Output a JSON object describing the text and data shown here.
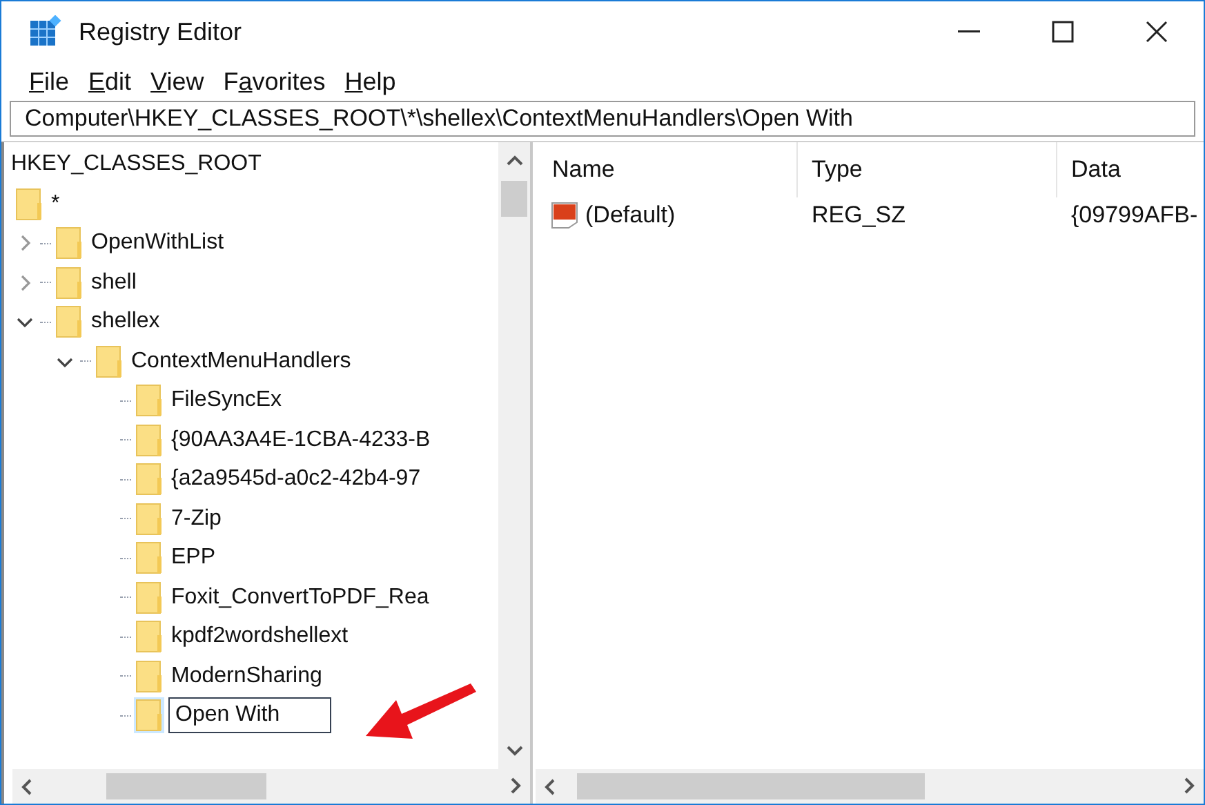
{
  "window": {
    "title": "Registry Editor"
  },
  "menu": [
    {
      "key": "F",
      "rest": "ile"
    },
    {
      "key": "E",
      "rest": "dit"
    },
    {
      "key": "V",
      "rest": "iew"
    },
    {
      "pre": "F",
      "key": "a",
      "rest": "vorites"
    },
    {
      "key": "H",
      "rest": "elp"
    }
  ],
  "address": "Computer\\HKEY_CLASSES_ROOT\\*\\shellex\\ContextMenuHandlers\\Open With",
  "tree": [
    {
      "label": "HKEY_CLASSES_ROOT",
      "children": [
        {
          "label": "*",
          "children": [
            {
              "label": "OpenWithList",
              "expanded": false
            },
            {
              "label": "shell",
              "expanded": false
            },
            {
              "label": "shellex",
              "expanded": true,
              "children": [
                {
                  "label": "ContextMenuHandlers",
                  "expanded": true,
                  "children": [
                    {
                      "label": "FileSyncEx",
                      "selected": false
                    },
                    {
                      "label": "{90AA3A4E-1CBA-4233-B",
                      "selected": false
                    },
                    {
                      "label": "{a2a9545d-a0c2-42b4-97",
                      "selected": false
                    },
                    {
                      "label": "7-Zip",
                      "selected": false
                    },
                    {
                      "label": "EPP",
                      "selected": false
                    },
                    {
                      "label": "Foxit_ConvertToPDF_Rea",
                      "selected": false
                    },
                    {
                      "label": "kpdf2wordshellext",
                      "selected": false
                    },
                    {
                      "label": "ModernSharing",
                      "selected": false
                    },
                    {
                      "label": "Open With",
                      "selected": true,
                      "editing": true
                    }
                  ]
                }
              ]
            }
          ]
        }
      ]
    }
  ],
  "columns": [
    "Name",
    "Type",
    "Data"
  ],
  "values": [
    {
      "name": "(Default)",
      "type": "REG_SZ",
      "data": "{09799AFB-"
    }
  ]
}
